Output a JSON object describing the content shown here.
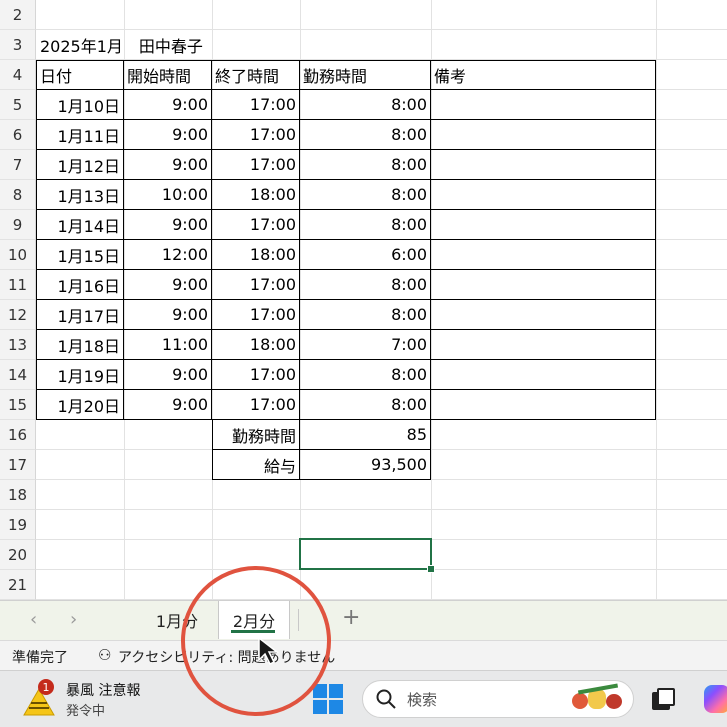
{
  "sheet": {
    "row_numbers": [
      "2",
      "3",
      "4",
      "5",
      "6",
      "7",
      "8",
      "9",
      "10",
      "11",
      "12",
      "13",
      "14",
      "15",
      "16",
      "17",
      "18",
      "19",
      "20",
      "21"
    ],
    "title": "2025年1月　田中春子",
    "headers": [
      "日付",
      "開始時間",
      "終了時間",
      "勤務時間",
      "備考"
    ],
    "rows": [
      [
        "1月10日",
        "9:00",
        "17:00",
        "8:00",
        ""
      ],
      [
        "1月11日",
        "9:00",
        "17:00",
        "8:00",
        ""
      ],
      [
        "1月12日",
        "9:00",
        "17:00",
        "8:00",
        ""
      ],
      [
        "1月13日",
        "10:00",
        "18:00",
        "8:00",
        ""
      ],
      [
        "1月14日",
        "9:00",
        "17:00",
        "8:00",
        ""
      ],
      [
        "1月15日",
        "12:00",
        "18:00",
        "6:00",
        ""
      ],
      [
        "1月16日",
        "9:00",
        "17:00",
        "8:00",
        ""
      ],
      [
        "1月17日",
        "9:00",
        "17:00",
        "8:00",
        ""
      ],
      [
        "1月18日",
        "11:00",
        "18:00",
        "7:00",
        ""
      ],
      [
        "1月19日",
        "9:00",
        "17:00",
        "8:00",
        ""
      ],
      [
        "1月20日",
        "9:00",
        "17:00",
        "8:00",
        ""
      ]
    ],
    "summary": [
      {
        "label": "勤務時間",
        "value": "85"
      },
      {
        "label": "給与",
        "value": "93,500"
      }
    ]
  },
  "tabs": {
    "prev_icon": "‹",
    "next_icon": "›",
    "items": [
      "1月分",
      "2月分"
    ],
    "active": "2月分",
    "add_icon": "+"
  },
  "status": {
    "ready": "準備完了",
    "accessibility": "アクセシビリティ: 問題ありません"
  },
  "taskbar": {
    "notification_badge": "1",
    "weather_title": "暴風 注意報",
    "weather_sub": "発令中",
    "search_placeholder": "検索"
  },
  "colors": {
    "accent": "#217346",
    "highlight_circle": "#e0533f"
  }
}
